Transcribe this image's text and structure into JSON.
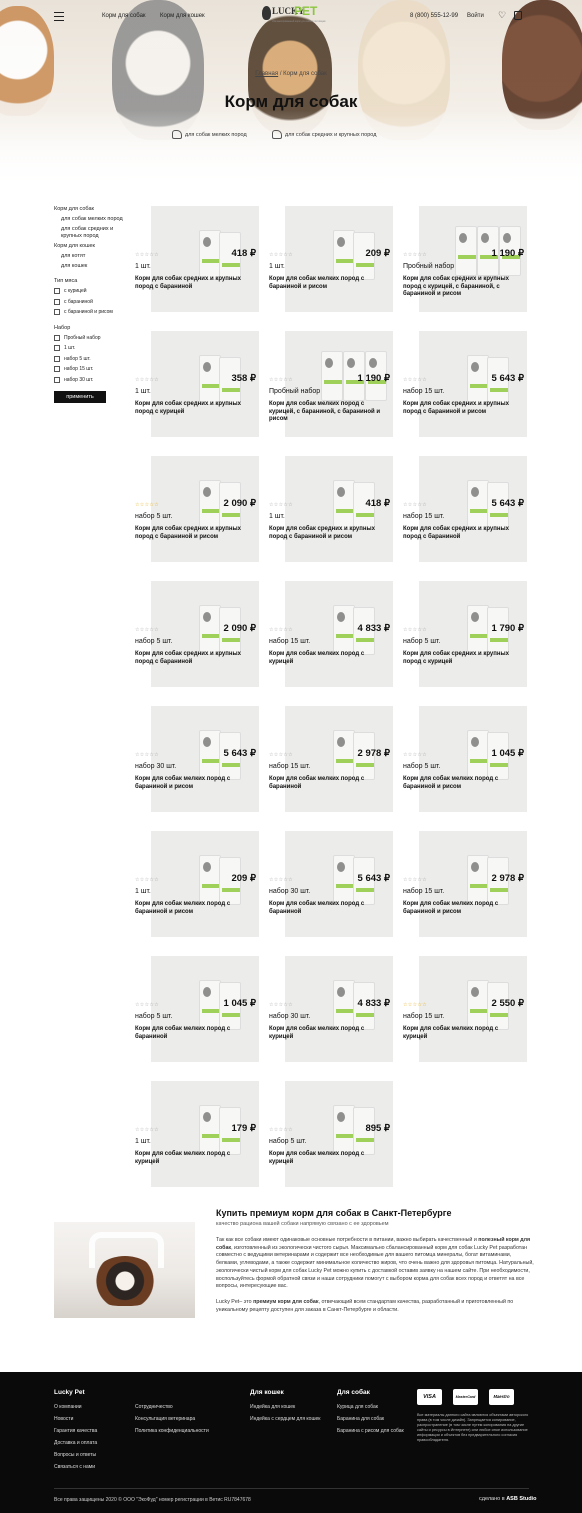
{
  "header": {
    "nav": [
      "Корм для собак",
      "Корм для кошек"
    ],
    "logo": {
      "word1": "LUCKY",
      "word2": "PET",
      "tagline": "сбалансированный корм для ваших питомцев"
    },
    "phone": "8 (800) 555-12-99",
    "login": "Войти"
  },
  "breadcrumb": {
    "home": "Главная",
    "separator": "/",
    "current": "Корм для собак"
  },
  "page_title": "Корм для собак",
  "subcategories": [
    "для собак мелких пород",
    "для собак средних и крупных пород"
  ],
  "sidebar": {
    "dogs_head": "Корм для собак",
    "dogs_items": [
      "для собак мелких пород",
      "для собак средних и крупных пород"
    ],
    "cats_head": "Корм для кошек",
    "cats_items": [
      "для котят",
      "для кошек"
    ],
    "meat_head": "Тип мяса",
    "meat_options": [
      "с курицей",
      "с бараниной",
      "с бараниной и рисом"
    ],
    "set_head": "Набор",
    "set_options": [
      "Пробный набор",
      "1 шт.",
      "набор 5 шт.",
      "набор 15 шт.",
      "набор 30 шт."
    ],
    "apply": "применить"
  },
  "products": [
    {
      "price": "418 ₽",
      "qty": "1 шт.",
      "name": "Корм для собак средних и крупных пород с бараниной",
      "multi": false,
      "gold": false
    },
    {
      "price": "209 ₽",
      "qty": "1 шт.",
      "name": "Корм для собак мелких пород с бараниной и рисом",
      "multi": false,
      "gold": false
    },
    {
      "price": "1 190 ₽",
      "qty": "Пробный набор",
      "name": "Корм для собак средних и крупных пород с курицей, с бараниной, с бараниной и рисом",
      "multi": true,
      "gold": false
    },
    {
      "price": "358 ₽",
      "qty": "1 шт.",
      "name": "Корм для собак средних и крупных пород с курицей",
      "multi": false,
      "gold": false
    },
    {
      "price": "1 190 ₽",
      "qty": "Пробный набор",
      "name": "Корм для собак мелких пород с курицей, с бараниной, с бараниной и рисом",
      "multi": true,
      "gold": false
    },
    {
      "price": "5 643 ₽",
      "qty": "набор 15 шт.",
      "name": "Корм для собак средних и крупных пород с бараниной и рисом",
      "multi": false,
      "gold": false
    },
    {
      "price": "2 090 ₽",
      "qty": "набор 5 шт.",
      "name": "Корм для собак средних и крупных пород с бараниной и рисом",
      "multi": false,
      "gold": true
    },
    {
      "price": "418 ₽",
      "qty": "1 шт.",
      "name": "Корм для собак средних и крупных пород с бараниной и рисом",
      "multi": false,
      "gold": false
    },
    {
      "price": "5 643 ₽",
      "qty": "набор 15 шт.",
      "name": "Корм для собак средних и крупных пород с бараниной",
      "multi": false,
      "gold": false
    },
    {
      "price": "2 090 ₽",
      "qty": "набор 5 шт.",
      "name": "Корм для собак средних и крупных пород с бараниной",
      "multi": false,
      "gold": false
    },
    {
      "price": "4 833 ₽",
      "qty": "набор 15 шт.",
      "name": "Корм для собак мелких пород с курицей",
      "multi": false,
      "gold": false
    },
    {
      "price": "1 790 ₽",
      "qty": "набор 5 шт.",
      "name": "Корм для собак средних и крупных пород с курицей",
      "multi": false,
      "gold": false
    },
    {
      "price": "5 643 ₽",
      "qty": "набор 30 шт.",
      "name": "Корм для собак мелких пород с бараниной и рисом",
      "multi": false,
      "gold": false
    },
    {
      "price": "2 978 ₽",
      "qty": "набор 15 шт.",
      "name": "Корм для собак мелких пород с бараниной",
      "multi": false,
      "gold": false
    },
    {
      "price": "1 045 ₽",
      "qty": "набор 5 шт.",
      "name": "Корм для собак мелких пород с бараниной и рисом",
      "multi": false,
      "gold": false
    },
    {
      "price": "209 ₽",
      "qty": "1 шт.",
      "name": "Корм для собак мелких пород с бараниной и рисом",
      "multi": false,
      "gold": false
    },
    {
      "price": "5 643 ₽",
      "qty": "набор 30 шт.",
      "name": "Корм для собак мелких пород с бараниной",
      "multi": false,
      "gold": false
    },
    {
      "price": "2 978 ₽",
      "qty": "набор 15 шт.",
      "name": "Корм для собак мелких пород с бараниной и рисом",
      "multi": false,
      "gold": false
    },
    {
      "price": "1 045 ₽",
      "qty": "набор 5 шт.",
      "name": "Корм для собак мелких пород с бараниной",
      "multi": false,
      "gold": false
    },
    {
      "price": "4 833 ₽",
      "qty": "набор 30 шт.",
      "name": "Корм для собак мелких пород с курицей",
      "multi": false,
      "gold": false
    },
    {
      "price": "2 550 ₽",
      "qty": "набор 15 шт.",
      "name": "Корм для собак мелких пород с курицей",
      "multi": false,
      "gold": true
    },
    {
      "price": "179 ₽",
      "qty": "1 шт.",
      "name": "Корм для собак мелких пород с курицей",
      "multi": false,
      "gold": false
    },
    {
      "price": "895 ₽",
      "qty": "набор 5 шт.",
      "name": "Корм для собак мелких пород с курицей",
      "multi": false,
      "gold": false
    }
  ],
  "about": {
    "title": "Купить премиум корм для собак в Санкт-Петербурге",
    "subtitle": "качество рациона вашей собаки напрямую связано с ее здоровьем",
    "p1_a": "Так как все собаки имеют одинаковые основные потребности в питании, важно выбирать качественный и ",
    "p1_bold": "полезный корм для собак",
    "p1_b": ", изготовленный из экологически чистого сырья. Максимально сбалансированный корм для собак Lucky Pet разработан совместно с ведущими ветеринарами и содержит все необходимые для вашего питомца минералы, богат витаминами, белками, углеводами, а также содержит минимальное количество жиров, что очень важно для здоровья питомца. Натуральный, экологически чистый корм для собак Lucky Pet можно купить с доставкой оставив заявку на нашем сайте. При необходимости, воспользуйтесь формой обратной связи и наши сотрудники помогут с выбором корма для собак всех пород и ответят на все вопросы, интересующие вас.",
    "p2_a": "Lucky Pet– это ",
    "p2_bold": "премиум корм для собак",
    "p2_b": ", отвечающий всем стандартам качества, разработанный и приготовленный по уникальному рецепту доступен для заказа в Санкт-Петербурге и области."
  },
  "footer": {
    "brand": "Lucky Pet",
    "col1": [
      "О компании",
      "Новости",
      "Гарантия качества",
      "Доставка и оплата",
      "Вопросы и ответы",
      "Связаться с нами"
    ],
    "col2": [
      "Сотрудничество",
      "Консультация ветеринара",
      "Политика конфиденциальности"
    ],
    "cats_title": "Для кошек",
    "cats_links": [
      "Индейка для кошек",
      "Индейка с сердцем для кошек"
    ],
    "dogs_title": "Для собак",
    "dogs_links": [
      "Курица для собак",
      "Баранина для собак",
      "Баранина с рисом для собак"
    ],
    "cards": [
      "VISA",
      "MasterCard",
      "Maestro"
    ],
    "note": "Все материалы данного сайта являются объектами авторского права (в том числе дизайн). Запрещается копирование, распространение (в том числе путем копирования на другие сайты и ресурсы в Интернете) или любое иное использование информации и объектов без предварительного согласия правообладателя.",
    "copyright": "Все права защищены 2020 © ООО \"ЭкоФуд\" номер регистрации в Ветис RU7847678",
    "made_by": "сделано в",
    "studio": "ASB Studio"
  }
}
